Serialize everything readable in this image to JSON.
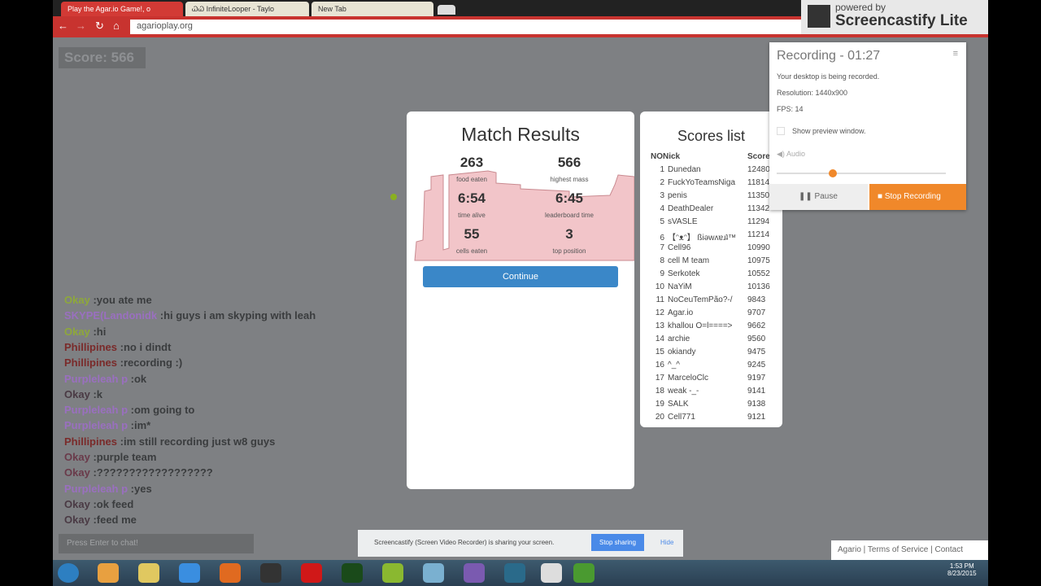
{
  "browser": {
    "tabs": [
      {
        "label": "Play the Agar.io Game!, o"
      },
      {
        "label": "ᏇᏇ InfiniteLooper - Taylo"
      },
      {
        "label": "New Tab"
      }
    ],
    "url": "agarioplay.org"
  },
  "game": {
    "score": "Score: 566"
  },
  "match": {
    "title": "Match Results",
    "stats": [
      {
        "value": "263",
        "label": "food eaten"
      },
      {
        "value": "566",
        "label": "highest mass"
      },
      {
        "value": "6:54",
        "label": "time alive"
      },
      {
        "value": "6:45",
        "label": "leaderboard time"
      },
      {
        "value": "55",
        "label": "cells eaten"
      },
      {
        "value": "3",
        "label": "top position"
      }
    ],
    "continue": "Continue"
  },
  "scores": {
    "title": "Scores list",
    "headers": [
      "NO",
      "Nick",
      "Score"
    ],
    "rows": [
      [
        "1",
        "Dunedan",
        "12480"
      ],
      [
        "2",
        "FuckYoTeamsNiga",
        "11814"
      ],
      [
        "3",
        "penis",
        "11350"
      ],
      [
        "4",
        "DeathDealer",
        "11342"
      ],
      [
        "5",
        "sVASLE",
        "11294"
      ],
      [
        "6",
        "【ᵔᴥᵔ】 ßiǝwʌɐɹʇ™",
        "11214"
      ],
      [
        "7",
        "Cell96",
        "10990"
      ],
      [
        "8",
        "cell M team",
        "10975"
      ],
      [
        "9",
        "Serkotek",
        "10552"
      ],
      [
        "10",
        "NaYiM",
        "10136"
      ],
      [
        "11",
        "NoCeuTemPão?-/",
        "9843"
      ],
      [
        "12",
        "Agar.io",
        "9707"
      ],
      [
        "13",
        "khallou O=l====>",
        "9662"
      ],
      [
        "14",
        "archie",
        "9560"
      ],
      [
        "15",
        "okiandy",
        "9475"
      ],
      [
        "16",
        "^_^",
        "9245"
      ],
      [
        "17",
        "MarceloClc",
        "9197"
      ],
      [
        "18",
        "weak -_-",
        "9141"
      ],
      [
        "19",
        "SALK",
        "9138"
      ],
      [
        "20",
        "Cell771",
        "9121"
      ]
    ]
  },
  "recorder": {
    "brand_top": "powered by",
    "brand": "Screencastify Lite",
    "title": "Recording - 01:27",
    "desc": "Your desktop is being recorded.",
    "resolution": "Resolution: 1440x900",
    "fps": "FPS: 14",
    "preview": "Show preview window.",
    "audio": "Audio",
    "audio_level": 0.33,
    "pause": "Pause",
    "stop": "Stop Recording",
    "accent": "#f0882a"
  },
  "chat": {
    "placeholder": "Press Enter to chat!",
    "messages": [
      {
        "name": "Okay",
        "text": ":you ate me",
        "color": "#8ea83a"
      },
      {
        "name": "SKYPE(Landonidk",
        "text": "  :hi guys i am skyping with leah",
        "color": "#9a6fc0"
      },
      {
        "name": "Okay",
        "text": ":hi",
        "color": "#8ea83a"
      },
      {
        "name": "Phillipines",
        "text": ":no i dindt",
        "color": "#7a2a2a"
      },
      {
        "name": "Phillipines",
        "text": ":recording :)",
        "color": "#7a2a2a"
      },
      {
        "name": "Purpleleah p",
        "text": ":ok",
        "color": "#9a6fc0"
      },
      {
        "name": "Okay",
        "text": ":k",
        "color": "#4a3a44"
      },
      {
        "name": "Purpleleah p",
        "text": ":om going to",
        "color": "#9a6fc0"
      },
      {
        "name": "Purpleleah p",
        "text": ":im*",
        "color": "#9a6fc0"
      },
      {
        "name": "Phillipines",
        "text": ":im still recording just w8 guys",
        "color": "#7a2a2a"
      },
      {
        "name": "Okay",
        "text": ":purple team",
        "color": "#6a3a4a"
      },
      {
        "name": "Okay",
        "text": ":??????????????????",
        "color": "#6a3a4a"
      },
      {
        "name": "Purpleleah p",
        "text": ":yes",
        "color": "#9a6fc0"
      },
      {
        "name": "Okay",
        "text": ":ok feed",
        "color": "#4a3a44"
      },
      {
        "name": "Okay",
        "text": ":feed me",
        "color": "#4a3a44"
      }
    ]
  },
  "share_bar": {
    "text": "Screencastify (Screen Video Recorder) is sharing your screen.",
    "stop": "Stop sharing",
    "hide": "Hide"
  },
  "footer": {
    "links": [
      "Agario",
      "Terms of Service",
      "Contact"
    ]
  },
  "taskbar": {
    "time": "1:53 PM",
    "date": "8/23/2015"
  }
}
